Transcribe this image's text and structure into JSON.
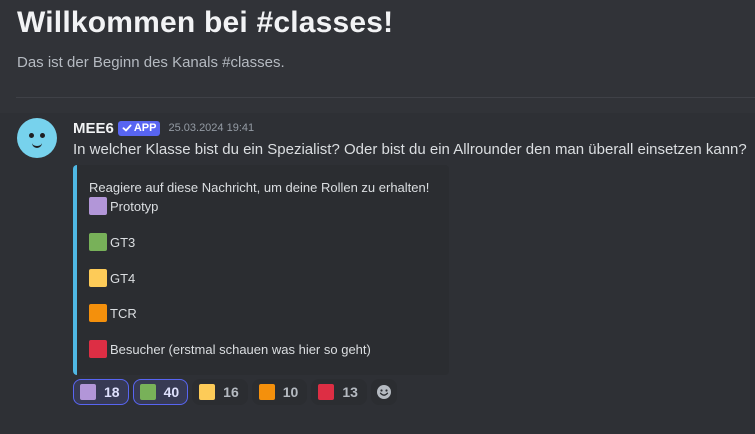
{
  "welcome": {
    "title": "Willkommen bei #classes!",
    "subtitle": "Das ist der Beginn des Kanals #classes."
  },
  "message": {
    "author": "MEE6",
    "badge": "APP",
    "timestamp": "25.03.2024 19:41",
    "content": "In welcher Klasse bist du ein Spezialist? Oder bist du ein Allrounder den man überall einsetzen kann?",
    "embed": {
      "accent_color": "#4fb8e4",
      "description": "Reagiere auf diese Nachricht, um deine Rollen zu erhalten!",
      "roles": [
        {
          "label": "Prototyp",
          "color": "#b296d8"
        },
        {
          "label": "GT3",
          "color": "#78b159"
        },
        {
          "label": "GT4",
          "color": "#fdcb58"
        },
        {
          "label": "TCR",
          "color": "#f4900c"
        },
        {
          "label": "Besucher (erstmal schauen was hier so geht)",
          "color": "#dd2e44"
        }
      ]
    }
  },
  "reactions": [
    {
      "emoji": "purple-square",
      "color": "#b296d8",
      "count": "18",
      "active": true
    },
    {
      "emoji": "green-square",
      "color": "#78b159",
      "count": "40",
      "active": true
    },
    {
      "emoji": "yellow-square",
      "color": "#fdcb58",
      "count": "16",
      "active": false
    },
    {
      "emoji": "orange-square",
      "color": "#f4900c",
      "count": "10",
      "active": false
    },
    {
      "emoji": "red-square",
      "color": "#dd2e44",
      "count": "13",
      "active": false
    }
  ],
  "add_reaction_icon": "add-reaction-smiley-icon",
  "accent_color": "#5865f2"
}
